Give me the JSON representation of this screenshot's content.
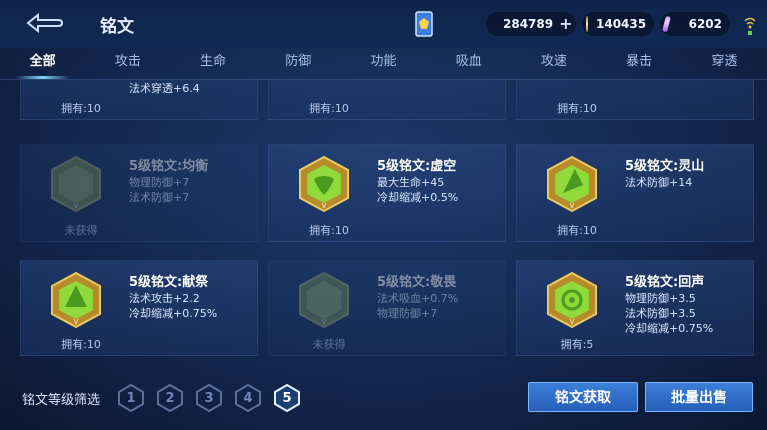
{
  "header": {
    "title": "铭文",
    "currencies": {
      "diamond": "284789",
      "gold": "140435",
      "gem": "6202"
    }
  },
  "tabs": [
    "全部",
    "攻击",
    "生命",
    "防御",
    "功能",
    "吸血",
    "攻速",
    "暴击",
    "穿透"
  ],
  "cards": [
    {
      "name": "",
      "attrs": [
        "法术穿透+6.4"
      ],
      "owned": "拥有:10",
      "dim": false
    },
    {
      "name": "",
      "attrs": [],
      "owned": "拥有:10",
      "dim": false
    },
    {
      "name": "",
      "attrs": [],
      "owned": "拥有:10",
      "dim": false
    },
    {
      "name": "5级铭文:均衡",
      "attrs": [
        "物理防御+7",
        "法术防御+7"
      ],
      "owned": "未获得",
      "dim": true
    },
    {
      "name": "5级铭文:虚空",
      "attrs": [
        "最大生命+45",
        "冷却缩减+0.5%"
      ],
      "owned": "拥有:10",
      "dim": false
    },
    {
      "name": "5级铭文:灵山",
      "attrs": [
        "法术防御+14"
      ],
      "owned": "拥有:10",
      "dim": false
    },
    {
      "name": "5级铭文:献祭",
      "attrs": [
        "法术攻击+2.2",
        "冷却缩减+0.75%"
      ],
      "owned": "拥有:10",
      "dim": false
    },
    {
      "name": "5级铭文:敬畏",
      "attrs": [
        "法术吸血+0.7%",
        "物理防御+7"
      ],
      "owned": "未获得",
      "dim": true
    },
    {
      "name": "5级铭文:回声",
      "attrs": [
        "物理防御+3.5",
        "法术防御+3.5",
        "冷却缩减+0.75%"
      ],
      "owned": "拥有:5",
      "dim": false
    }
  ],
  "footer": {
    "filter_label": "铭文等级筛选",
    "levels": [
      "1",
      "2",
      "3",
      "4",
      "5"
    ],
    "active_level": "5",
    "get_label": "铭文获取",
    "sell_label": "批量出售"
  },
  "colors": {
    "accent": "#7fd7ff",
    "button": "#2f6fc8",
    "gem_green": "#8fd93a",
    "gem_gold": "#c9a33a"
  }
}
